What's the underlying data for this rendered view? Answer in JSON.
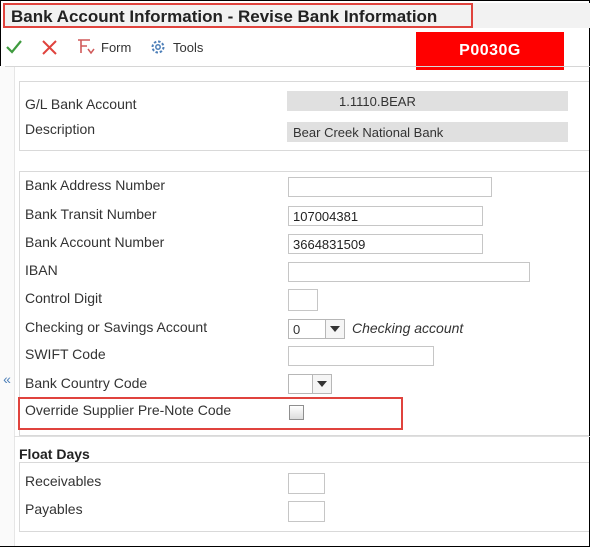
{
  "window": {
    "title": "Bank Account Information - Revise Bank Information"
  },
  "toolbar": {
    "form_label": "Form",
    "tools_label": "Tools"
  },
  "badge": "P0030G",
  "header": {
    "gl_bank_account_label": "G/L Bank Account",
    "gl_bank_account_value": "1.1110.BEAR",
    "description_label": "Description",
    "description_value": "Bear Creek National Bank"
  },
  "bank": {
    "address_number_label": "Bank Address Number",
    "address_number_value": "",
    "transit_label": "Bank Transit Number",
    "transit_value": "107004381",
    "account_label": "Bank Account Number",
    "account_value": "3664831509",
    "iban_label": "IBAN",
    "iban_value": "",
    "control_digit_label": "Control Digit",
    "control_digit_value": "",
    "checking_savings_label": "Checking or Savings Account",
    "checking_savings_value": "0",
    "checking_savings_desc": "Checking account",
    "swift_label": "SWIFT Code",
    "swift_value": "",
    "country_label": "Bank Country Code",
    "country_value": "",
    "override_label": "Override Supplier Pre-Note Code",
    "override_checked": false
  },
  "float_days": {
    "title": "Float Days",
    "receivables_label": "Receivables",
    "receivables_value": "",
    "payables_label": "Payables",
    "payables_value": ""
  },
  "colors": {
    "accent_red": "#e0433d",
    "badge_red": "#ff0000",
    "ok_green": "#3f9b3f",
    "link_blue": "#4d7fb8"
  },
  "icons": {
    "ok": "check-icon",
    "cancel": "close-icon",
    "form": "form-icon",
    "tools": "gear-icon",
    "collapse": "double-chevron-left-icon"
  }
}
